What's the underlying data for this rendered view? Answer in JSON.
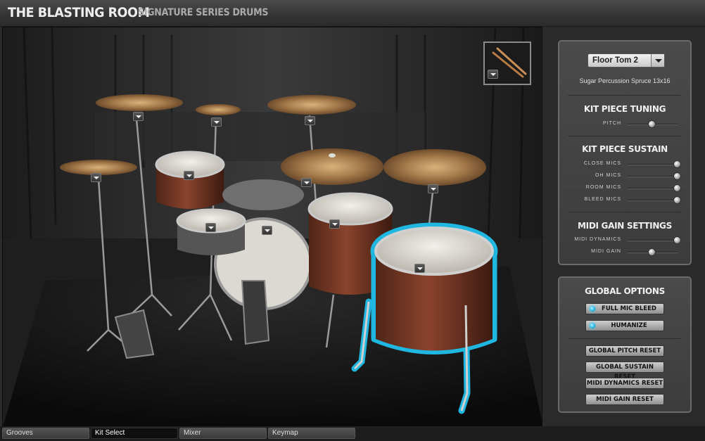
{
  "header": {
    "brand": "THE BLASTING ROOM",
    "subtitle": "SIGNATURE SERIES DRUMS"
  },
  "kit_piece": {
    "selected": "Floor Tom 2",
    "description": "Sugar Percussion Spruce 13x16"
  },
  "tuning": {
    "title": "KIT PIECE TUNING",
    "pitch_label": "PITCH",
    "pitch_value": 0.5
  },
  "sustain": {
    "title": "KIT PIECE SUSTAIN",
    "close_label": "CLOSE MICS",
    "close_value": 1.0,
    "oh_label": "OH MICS",
    "oh_value": 1.0,
    "room_label": "ROOM MICS",
    "room_value": 1.0,
    "bleed_label": "BLEED MICS",
    "bleed_value": 1.0
  },
  "midi": {
    "title": "MIDI GAIN SETTINGS",
    "dynamics_label": "MIDI DYNAMICS",
    "dynamics_value": 1.0,
    "gain_label": "MIDI GAIN",
    "gain_value": 0.5
  },
  "global": {
    "title": "GLOBAL OPTIONS",
    "full_mic_bleed": "FULL MIC BLEED",
    "humanize": "HUMANIZE",
    "pitch_reset": "GLOBAL PITCH RESET",
    "sustain_reset": "GLOBAL SUSTAIN RESET",
    "dynamics_reset": "MIDI DYNAMICS RESET",
    "gain_reset": "MIDI GAIN RESET"
  },
  "tabs": {
    "grooves": "Grooves",
    "kit_select": "Kit Select",
    "mixer": "Mixer",
    "keymap": "Keymap"
  },
  "colors": {
    "highlight": "#1fb6e0",
    "shell": "#7a3a26"
  }
}
